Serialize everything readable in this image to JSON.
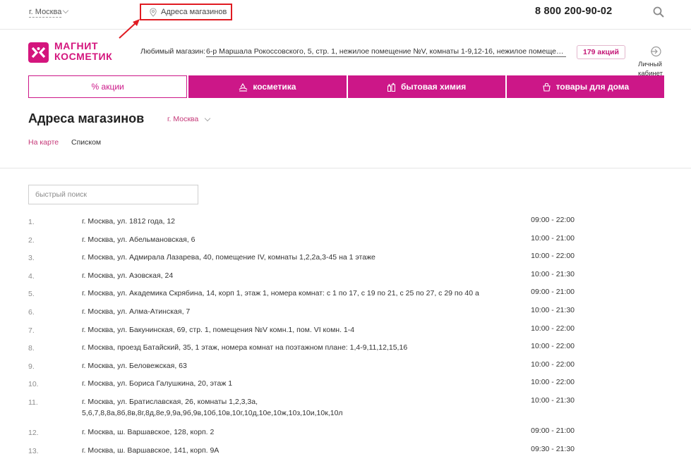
{
  "topbar": {
    "city": "г. Москва",
    "store_addresses_link": "Адреса магазинов",
    "phone": "8 800 200-90-02"
  },
  "header": {
    "logo_text_line1": "МАГНИТ",
    "logo_text_line2": "КОСМЕТИК",
    "favorite_label": "Любимый магазин:",
    "favorite_store": "6-р Маршала Рокоссовского, 5, стр. 1, нежилое помещение №V, комнаты 1-9,12-16, нежилое помещение №IV...",
    "promo_badge": "179 акций",
    "account_label": "Личный кабинет"
  },
  "tabs": [
    {
      "label": "% акции",
      "icon": "percent"
    },
    {
      "label": "косметика",
      "icon": "cosmetics-icon"
    },
    {
      "label": "бытовая химия",
      "icon": "household-chemicals-icon"
    },
    {
      "label": "товары для дома",
      "icon": "home-goods-icon"
    }
  ],
  "page": {
    "title": "Адреса магазинов",
    "city": "г. Москва",
    "view_map": "На карте",
    "view_list": "Списком"
  },
  "search": {
    "placeholder": "быстрый поиск",
    "value": ""
  },
  "stores": [
    {
      "n": "1.",
      "address": "г. Москва, ул. 1812 года, 12",
      "hours": "09:00 - 22:00"
    },
    {
      "n": "2.",
      "address": "г. Москва, ул. Абельмановская, 6",
      "hours": "10:00 - 21:00"
    },
    {
      "n": "3.",
      "address": "г. Москва, ул. Адмирала Лазарева, 40, помещение IV, комнаты 1,2,2а,3-45 на 1 этаже",
      "hours": "10:00 - 22:00"
    },
    {
      "n": "4.",
      "address": "г. Москва, ул. Азовская, 24",
      "hours": "10:00 - 21:30"
    },
    {
      "n": "5.",
      "address": "г. Москва, ул. Академика Скрябина, 14, корп 1, этаж 1, номера комнат: с 1 по 17, с 19 по 21, с 25 по 27, с 29 по 40 а",
      "hours": "09:00 - 21:00"
    },
    {
      "n": "6.",
      "address": "г. Москва, ул. Алма-Атинская, 7",
      "hours": "10:00 - 21:30"
    },
    {
      "n": "7.",
      "address": "г. Москва, ул. Бакунинская, 69, стр. 1, помещения №V комн.1, пом. VI комн. 1-4",
      "hours": "10:00 - 22:00"
    },
    {
      "n": "8.",
      "address": "г. Москва, проезд Батайский, 35, 1 этаж, номера комнат на поэтажном плане: 1,4-9,11,12,15,16",
      "hours": "10:00 - 22:00"
    },
    {
      "n": "9.",
      "address": "г. Москва, ул. Беловежская, 63",
      "hours": "10:00 - 22:00"
    },
    {
      "n": "10.",
      "address": "г. Москва, ул. Бориса Галушкина, 20, этаж 1",
      "hours": "10:00 - 22:00"
    },
    {
      "n": "11.",
      "address": "г. Москва, ул. Братиславская, 26, комнаты 1,2,3,3а, 5,6,7,8,8а,8б,8в,8г,8д,8е,9,9а,9б,9в,10б,10в,10г,10д,10е,10ж,10з,10и,10к,10л",
      "hours": "10:00 - 21:30"
    },
    {
      "n": "12.",
      "address": "г. Москва, ш. Варшавское, 128, корп. 2",
      "hours": "09:00 - 21:00"
    },
    {
      "n": "13.",
      "address": "г. Москва, ш. Варшавское, 141, корп. 9А",
      "hours": "09:30 - 21:30"
    }
  ]
}
